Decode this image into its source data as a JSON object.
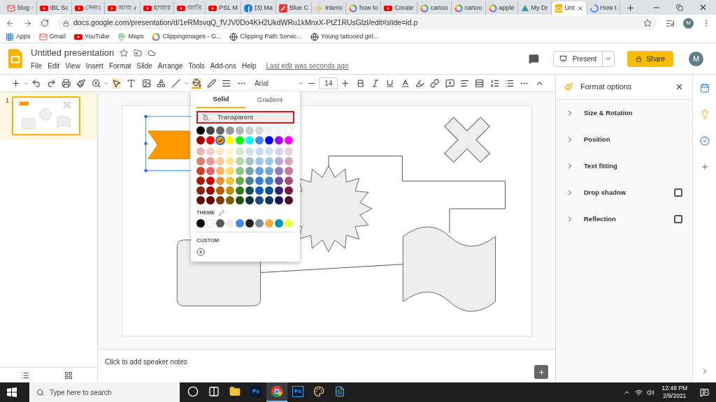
{
  "browser": {
    "tabs": [
      {
        "label": "blog -",
        "kind": "mail",
        "selected": false
      },
      {
        "label": "IBL Sc",
        "kind": "video",
        "selected": false
      },
      {
        "label": "সেনাঃ",
        "kind": "video",
        "selected": false
      },
      {
        "label": "আজ ৫",
        "kind": "video",
        "selected": false
      },
      {
        "label": "হাজার",
        "kind": "video",
        "selected": false
      },
      {
        "label": "জাতি",
        "kind": "video",
        "selected": false
      },
      {
        "label": "PSL M",
        "kind": "video",
        "selected": false
      },
      {
        "label": "(3) Ma",
        "kind": "social",
        "selected": false
      },
      {
        "label": "Blue C",
        "kind": "square",
        "selected": false
      },
      {
        "label": "Interio",
        "kind": "sun",
        "selected": false
      },
      {
        "label": "how to",
        "kind": "ring",
        "selected": false
      },
      {
        "label": "Create",
        "kind": "video",
        "selected": false
      },
      {
        "label": "cartoo",
        "kind": "ring",
        "selected": false
      },
      {
        "label": "cartoo",
        "kind": "ring",
        "selected": false
      },
      {
        "label": "apple",
        "kind": "ring",
        "selected": false
      },
      {
        "label": "My Dr",
        "kind": "drive",
        "selected": false
      },
      {
        "label": "Unt",
        "kind": "slides",
        "selected": true
      },
      {
        "label": "How t",
        "kind": "help",
        "selected": false
      }
    ],
    "address": "docs.google.com/presentation/d/1eRMsvqQ_fVJV0Do4KH2UkdWRu1kMnxX-PtZ1RUsGlzl/edit#slide=id.p",
    "profile": "M",
    "bookmarks": [
      {
        "label": "Apps",
        "kind": "apps"
      },
      {
        "label": "Gmail",
        "kind": "mail"
      },
      {
        "label": "YouTube",
        "kind": "video"
      },
      {
        "label": "Maps",
        "kind": "pin"
      },
      {
        "label": "Clippingimages - G...",
        "kind": "ring"
      },
      {
        "label": "Clipping Path Servic...",
        "kind": "globe"
      },
      {
        "label": "Young tattooed girl...",
        "kind": "globe"
      }
    ]
  },
  "doc": {
    "title": "Untitled presentation",
    "menus": [
      "File",
      "Edit",
      "View",
      "Insert",
      "Format",
      "Slide",
      "Arrange",
      "Tools",
      "Add-ons",
      "Help"
    ],
    "last_edit": "Last edit was seconds ago",
    "present": "Present",
    "share": "Share",
    "avatar": "M"
  },
  "toolbar": {
    "font": "Arial",
    "font_size": "14"
  },
  "fill_picker": {
    "tabs": [
      {
        "label": "Solid",
        "selected": true
      },
      {
        "label": "Gradient",
        "selected": false
      }
    ],
    "transparent": "Transparent",
    "rows": [
      [
        {
          "color": "#000000",
          "selected": false
        },
        {
          "color": "#434343",
          "selected": false
        },
        {
          "color": "#666666",
          "selected": false
        },
        {
          "color": "#999999",
          "selected": false
        },
        {
          "color": "#b7b7b7",
          "selected": false
        },
        {
          "color": "#cccccc",
          "selected": false
        },
        {
          "color": "#d9d9d9",
          "selected": false
        },
        {
          "color": "#efefef",
          "selected": false
        },
        {
          "color": "#f3f3f3",
          "selected": false
        },
        {
          "color": "#ffffff",
          "selected": false
        }
      ],
      [
        {
          "color": "#980000",
          "selected": false
        },
        {
          "color": "#ff0000",
          "selected": false
        },
        {
          "color": "#ff9900",
          "selected": true
        },
        {
          "color": "#ffff00",
          "selected": false
        },
        {
          "color": "#00ff00",
          "selected": false
        },
        {
          "color": "#00ffff",
          "selected": false
        },
        {
          "color": "#4a86e8",
          "selected": false
        },
        {
          "color": "#0000ff",
          "selected": false
        },
        {
          "color": "#9900ff",
          "selected": false
        },
        {
          "color": "#ff00ff",
          "selected": false
        }
      ],
      [
        {
          "color": "#e6b8af",
          "selected": false
        },
        {
          "color": "#f4cccc",
          "selected": false
        },
        {
          "color": "#fce5cd",
          "selected": false
        },
        {
          "color": "#fff2cc",
          "selected": false
        },
        {
          "color": "#d9ead3",
          "selected": false
        },
        {
          "color": "#d0e0e3",
          "selected": false
        },
        {
          "color": "#c9daf8",
          "selected": false
        },
        {
          "color": "#cfe2f3",
          "selected": false
        },
        {
          "color": "#d9d2e9",
          "selected": false
        },
        {
          "color": "#ead1dc",
          "selected": false
        }
      ],
      [
        {
          "color": "#dd7e6b",
          "selected": false
        },
        {
          "color": "#ea9999",
          "selected": false
        },
        {
          "color": "#f9cb9c",
          "selected": false
        },
        {
          "color": "#ffe599",
          "selected": false
        },
        {
          "color": "#b6d7a8",
          "selected": false
        },
        {
          "color": "#a2c4c9",
          "selected": false
        },
        {
          "color": "#a4c2f4",
          "selected": false
        },
        {
          "color": "#9fc5e8",
          "selected": false
        },
        {
          "color": "#b4a7d6",
          "selected": false
        },
        {
          "color": "#d5a6bd",
          "selected": false
        }
      ],
      [
        {
          "color": "#cc4125",
          "selected": false
        },
        {
          "color": "#e06666",
          "selected": false
        },
        {
          "color": "#f6b26b",
          "selected": false
        },
        {
          "color": "#ffd966",
          "selected": false
        },
        {
          "color": "#93c47d",
          "selected": false
        },
        {
          "color": "#76a5af",
          "selected": false
        },
        {
          "color": "#6d9eeb",
          "selected": false
        },
        {
          "color": "#6fa8dc",
          "selected": false
        },
        {
          "color": "#8e7cc3",
          "selected": false
        },
        {
          "color": "#c27ba0",
          "selected": false
        }
      ],
      [
        {
          "color": "#a61c00",
          "selected": false
        },
        {
          "color": "#cc0000",
          "selected": false
        },
        {
          "color": "#e69138",
          "selected": false
        },
        {
          "color": "#f1c232",
          "selected": false
        },
        {
          "color": "#6aa84f",
          "selected": false
        },
        {
          "color": "#45818e",
          "selected": false
        },
        {
          "color": "#3c78d8",
          "selected": false
        },
        {
          "color": "#3d85c6",
          "selected": false
        },
        {
          "color": "#674ea7",
          "selected": false
        },
        {
          "color": "#a64d79",
          "selected": false
        }
      ],
      [
        {
          "color": "#85200c",
          "selected": false
        },
        {
          "color": "#990000",
          "selected": false
        },
        {
          "color": "#b45f06",
          "selected": false
        },
        {
          "color": "#bf9000",
          "selected": false
        },
        {
          "color": "#38761d",
          "selected": false
        },
        {
          "color": "#134f5c",
          "selected": false
        },
        {
          "color": "#1155cc",
          "selected": false
        },
        {
          "color": "#0b5394",
          "selected": false
        },
        {
          "color": "#351c75",
          "selected": false
        },
        {
          "color": "#741b47",
          "selected": false
        }
      ],
      [
        {
          "color": "#5b0f00",
          "selected": false
        },
        {
          "color": "#660000",
          "selected": false
        },
        {
          "color": "#783f04",
          "selected": false
        },
        {
          "color": "#7f6000",
          "selected": false
        },
        {
          "color": "#274e13",
          "selected": false
        },
        {
          "color": "#0c343d",
          "selected": false
        },
        {
          "color": "#1c4587",
          "selected": false
        },
        {
          "color": "#073763",
          "selected": false
        },
        {
          "color": "#20124d",
          "selected": false
        },
        {
          "color": "#4c1130",
          "selected": false
        }
      ]
    ],
    "theme_label": "THEME",
    "theme": [
      {
        "color": "#000000",
        "selected": false
      },
      {
        "color": "#ffffff",
        "selected": false
      },
      {
        "color": "#595959",
        "selected": false
      },
      {
        "color": "#eeeeee",
        "selected": false
      },
      {
        "color": "#4285f4",
        "selected": false
      },
      {
        "color": "#212121",
        "selected": false
      },
      {
        "color": "#78909c",
        "selected": false
      },
      {
        "color": "#ffab40",
        "selected": false
      },
      {
        "color": "#0097a7",
        "selected": false
      },
      {
        "color": "#eeff41",
        "selected": false
      }
    ],
    "custom_label": "CUSTOM"
  },
  "filmstrip": {
    "slides": [
      {
        "number": "1",
        "selected": true
      }
    ]
  },
  "notes_placeholder": "Click to add speaker notes",
  "format_panel": {
    "title": "Format options",
    "sections": [
      {
        "label": "Size & Rotation",
        "kind": "plain"
      },
      {
        "label": "Position",
        "kind": "plain"
      },
      {
        "label": "Text fitting",
        "kind": "plain"
      },
      {
        "label": "Drop shadow",
        "kind": "checkbox",
        "checked": false
      },
      {
        "label": "Reflection",
        "kind": "checkbox",
        "checked": false
      }
    ]
  },
  "taskbar": {
    "search_placeholder": "Type here to search",
    "apps": [
      {
        "kind": "cortana",
        "selected": false
      },
      {
        "kind": "taskview",
        "selected": false
      },
      {
        "kind": "folder",
        "selected": false
      },
      {
        "kind": "ps-dark",
        "label": "Ps",
        "selected": false
      },
      {
        "kind": "chrome",
        "selected": true
      },
      {
        "kind": "ps",
        "label": "Ps",
        "selected": false
      },
      {
        "kind": "paint",
        "selected": false
      },
      {
        "kind": "doc",
        "selected": false
      }
    ],
    "time": "12:48 PM",
    "date": "2/9/2021"
  }
}
